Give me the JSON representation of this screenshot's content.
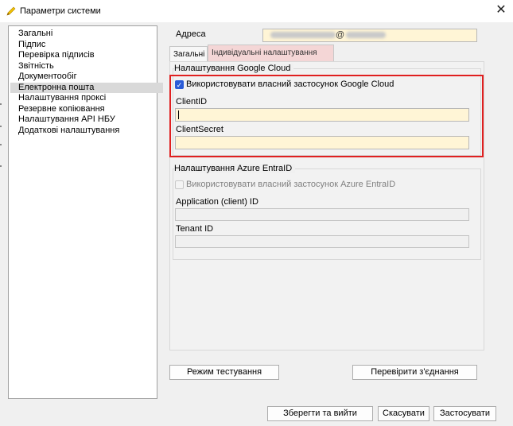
{
  "window": {
    "title": "Параметри системи",
    "icon": "pencil-icon"
  },
  "sidebar": {
    "items": [
      {
        "label": "Загальні"
      },
      {
        "label": "Підпис"
      },
      {
        "label": "Перевірка підписів"
      },
      {
        "label": "Звітність"
      },
      {
        "label": "Документообіг"
      },
      {
        "label": "Електронна пошта",
        "selected": true
      },
      {
        "label": "Налаштування проксі"
      },
      {
        "label": "Резервне копіювання"
      },
      {
        "label": "Налаштування API НБУ"
      },
      {
        "label": "Додаткові налаштування"
      }
    ]
  },
  "address": {
    "label": "Адреса",
    "at_symbol": "@"
  },
  "tabs": [
    {
      "label": "Загальні"
    },
    {
      "label": "Індивідуальні налаштування пошти",
      "active": true
    }
  ],
  "google": {
    "group_title": "Налаштування Google Cloud",
    "checkbox_label": "Використовувати власний застосунок Google Cloud",
    "checked": true,
    "client_id_label": "ClientID",
    "client_id_value": "",
    "client_secret_label": "ClientSecret",
    "client_secret_value": ""
  },
  "azure": {
    "group_title": "Налаштування Azure EntraID",
    "checkbox_label": "Використовувати власний застосунок Azure EntraID",
    "checked": false,
    "app_id_label": "Application (client) ID",
    "app_id_value": "",
    "tenant_id_label": "Tenant ID",
    "tenant_id_value": ""
  },
  "buttons": {
    "test_mode": "Режим тестування",
    "check_connection": "Перевірити з'єднання",
    "save_exit": "Зберегти та вийти",
    "cancel": "Скасувати",
    "apply": "Застосувати"
  },
  "colors": {
    "input_bg": "#fff5d6",
    "highlight_border": "#e02020",
    "active_tab_bg": "#f4d6d6",
    "checkbox_accent": "#2a5bd7"
  }
}
